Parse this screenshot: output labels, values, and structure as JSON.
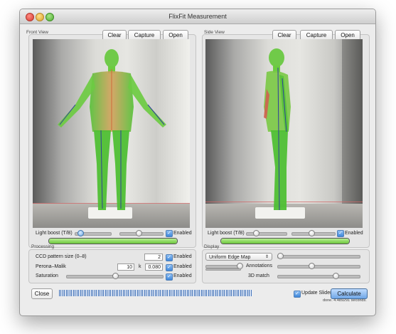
{
  "window": {
    "title": "FlixFit Measurement"
  },
  "front": {
    "section_label": "Front View",
    "clear": "Clear",
    "capture": "Capture",
    "open": "Open",
    "light_boost_label": "Light boost (T/B)",
    "enabled_label": "Enabled"
  },
  "side": {
    "section_label": "Side View",
    "clear": "Clear",
    "capture": "Capture",
    "open": "Open",
    "light_boost_label": "Light boost (T/B)",
    "enabled_label": "Enabled"
  },
  "processing": {
    "section_label": "Processing",
    "ccd_label": "CCD pattern size (0–8)",
    "ccd_value": "2",
    "ccd_enabled": "Enabled",
    "pm_label": "Perona–Malik",
    "pm_value": "10",
    "pm_k_label": "k",
    "pm_k_value": "0.080",
    "pm_enabled": "Enabled",
    "sat_label": "Saturation",
    "sat_enabled": "Enabled"
  },
  "display": {
    "section_label": "Display",
    "map_select": "Uniform Edge Map",
    "annotations_label": "Annotations",
    "match_label": "3D match"
  },
  "footer": {
    "close": "Close",
    "update_sliders": "Update Sliders",
    "calculate": "Calculate",
    "status": "done. 4.489291 seconds."
  }
}
